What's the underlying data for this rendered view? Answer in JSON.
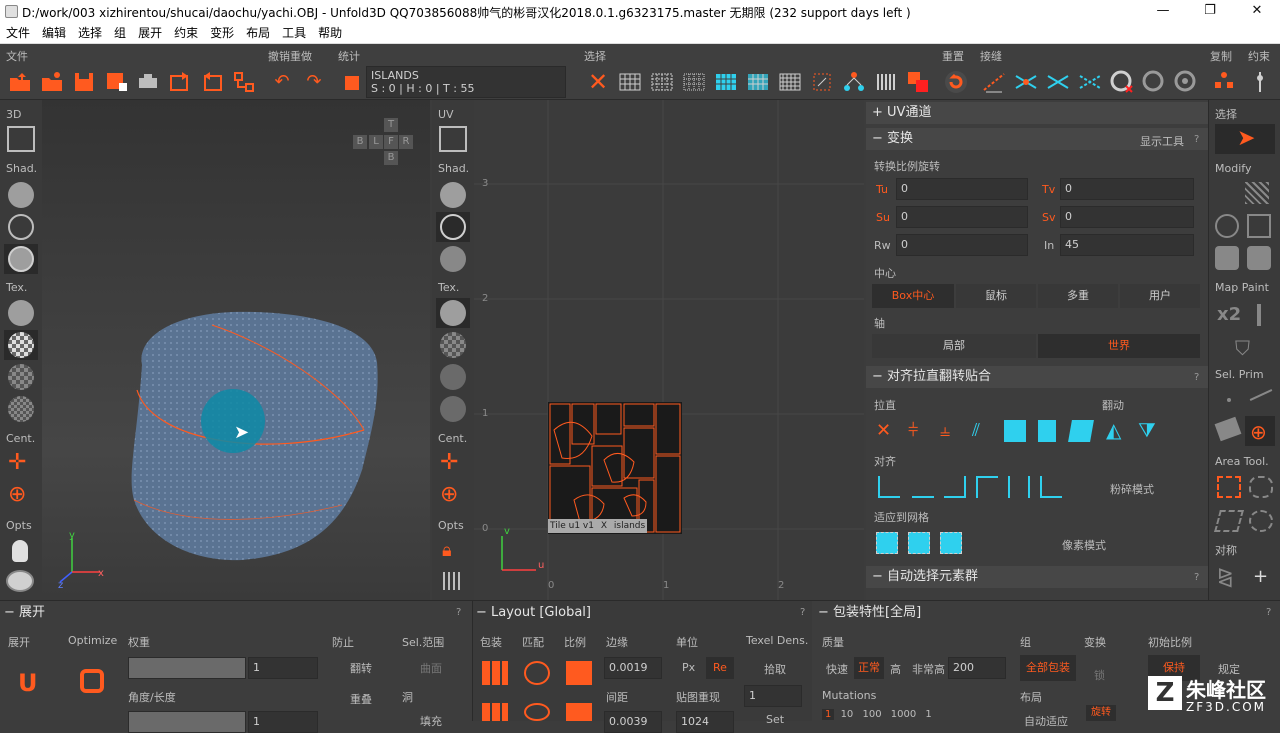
{
  "window": {
    "title": "D:/work/003 xizhirentou/shucai/daochu/yachi.OBJ - Unfold3D QQ703856088帅气的彬哥汉化2018.0.1.g6323175.master 无期限 (232 support days left )",
    "minimize": "—",
    "restore": "❐",
    "close": "✕"
  },
  "menu": [
    "文件",
    "编辑",
    "选择",
    "组",
    "展开",
    "约束",
    "变形",
    "布局",
    "工具",
    "帮助"
  ],
  "toolbar": {
    "sections": {
      "file": "文件",
      "undo_redo": "撤销重做",
      "stats": "统计",
      "select": "选择",
      "reset": "重置",
      "seam": "接缝",
      "copy": "复制",
      "constraint": "约束"
    },
    "info": {
      "line1": "ISLANDS",
      "line2": "S : 0 | H : 0 | T : 55"
    }
  },
  "left_col": {
    "labels": [
      "3D",
      "Shad.",
      "Tex.",
      "Cent.",
      "Opts"
    ]
  },
  "uv_col": {
    "labels": [
      "UV",
      "Shad.",
      "Tex.",
      "Cent.",
      "Opts"
    ]
  },
  "viewport3d": {
    "cube_labels": [
      "T",
      "B",
      "L",
      "F",
      "R",
      "B"
    ],
    "axes": {
      "x": "x",
      "y": "y",
      "z": "z"
    }
  },
  "uv_view": {
    "y_ticks": [
      "3",
      "2",
      "1",
      "0"
    ],
    "x_ticks": [
      "0",
      "1",
      "2"
    ],
    "axes": {
      "u": "u",
      "v": "v"
    },
    "tile_label": {
      "tile": "Tile u1 v1",
      "close": "X",
      "islands": "islands"
    }
  },
  "right_panel": {
    "uv_channel": "UV通道",
    "transform": {
      "title": "变换",
      "show_tools": "显示工具",
      "help": "?",
      "sub": "转换比例旋转",
      "fields": [
        {
          "label": "Tu",
          "value": "0",
          "highlight": true
        },
        {
          "label": "Tv",
          "value": "0",
          "highlight": true
        },
        {
          "label": "Su",
          "value": "0",
          "highlight": true
        },
        {
          "label": "Sv",
          "value": "0",
          "highlight": true
        },
        {
          "label": "Rw",
          "value": "0",
          "highlight": false
        },
        {
          "label": "In",
          "value": "45",
          "highlight": false
        }
      ],
      "center_label": "中心",
      "center_options": [
        "Box中心",
        "鼠标",
        "多重",
        "用户"
      ],
      "axis_label": "轴",
      "axis_options": [
        "局部",
        "世界"
      ]
    },
    "align": {
      "title": "对齐拉直翻转贴合",
      "help": "?",
      "straighten": "拉直",
      "flip": "翻动",
      "align": "对齐",
      "shatter_mode": "粉碎模式",
      "fit_grid": "适应到网格",
      "pixel_mode": "像素模式"
    },
    "auto_select": {
      "title": "自动选择元素群",
      "help": "?"
    }
  },
  "far_right": {
    "labels": [
      "选择",
      "Modify",
      "Map Paint",
      "Sel. Prim",
      "Area Tool.",
      "对称"
    ],
    "x2": "x2"
  },
  "bottom": {
    "unfold": {
      "title": "展开",
      "help": "?",
      "labels": {
        "unfold": "展开",
        "optimize": "Optimize",
        "weight": "权重",
        "prevent": "防止",
        "sel_range": "Sel.范围",
        "angle": "角度/长度",
        "flip": "翻转",
        "overlap": "重叠",
        "hole": "洞",
        "hole2": "曲面",
        "fill": "填充"
      },
      "weight_value": "1",
      "angle_value": "1"
    },
    "layout": {
      "title": "Layout [Global]",
      "help": "?",
      "labels": {
        "pack": "包装",
        "match": "匹配",
        "ratio": "比例",
        "margin": "边缘",
        "unit": "单位",
        "texel": "Texel Dens.",
        "spacing": "间距",
        "map_res": "贴图重现",
        "px": "Px",
        "re": "Re",
        "pick": "拾取"
      },
      "margin_value": "0.0019",
      "spacing_value": "0.0039",
      "res_value": "1024",
      "texel_value": "1",
      "set": "Set"
    },
    "pack": {
      "title": "包装特性[全局]",
      "help": "?",
      "labels": {
        "quality": "质量",
        "group": "组",
        "transform": "变换",
        "init_scale": "初始比例",
        "fast": "快速",
        "normal": "正常",
        "high": "高",
        "very_high": "非常高",
        "mutations": "Mutations",
        "layout": "布局",
        "all_pack": "全部包装",
        "lock": "锁",
        "keep": "保持",
        "fixed": "规定",
        "auto_fit": "自动适应",
        "rot": "旋转"
      },
      "quality_value": "200",
      "mutations_values": [
        "1",
        "10",
        "100",
        "1000",
        "1"
      ]
    }
  },
  "watermark": {
    "brand": "朱峰社区",
    "url": "ZF3D.COM"
  },
  "colors": {
    "accent": "#ff5a1f",
    "cyan": "#2fd0ee",
    "mesh": "#5a7392"
  }
}
